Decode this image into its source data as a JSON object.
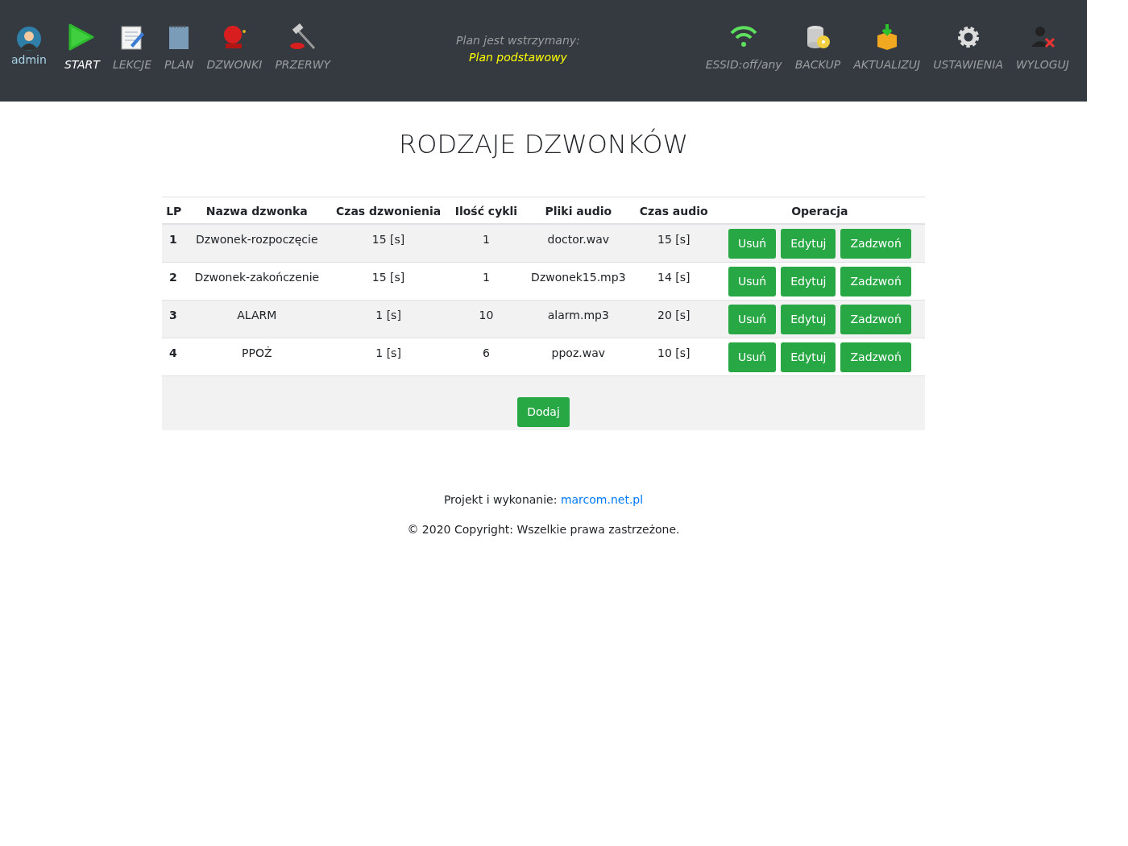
{
  "user": {
    "name": "admin"
  },
  "nav_left": [
    {
      "kind": "play",
      "label": "START",
      "selected": true
    },
    {
      "kind": "notepad",
      "label": "LEKCJE",
      "selected": false
    },
    {
      "kind": "notebook",
      "label": "PLAN",
      "selected": false
    },
    {
      "kind": "bell",
      "label": "DZWONKI",
      "selected": false
    },
    {
      "kind": "hammer",
      "label": "PRZERWY",
      "selected": false
    }
  ],
  "plan_status": {
    "line_1": "Plan jest wstrzymany:",
    "line_2": "Plan podstawowy"
  },
  "nav_right": [
    {
      "kind": "wifi",
      "label": "ESSID:off/any"
    },
    {
      "kind": "database",
      "label": "BACKUP"
    },
    {
      "kind": "box",
      "label": "AKTUALIZUJ"
    },
    {
      "kind": "gear",
      "label": "USTAWIENIA"
    },
    {
      "kind": "logout",
      "label": "WYLOGUJ"
    }
  ],
  "title": "RODZAJE DZWONKÓW",
  "table": {
    "columns": [
      "LP",
      "Nazwa dzwonka",
      "Czas dzwonienia",
      "Ilość cykli",
      "Pliki audio",
      "Czas audio",
      "Operacja"
    ],
    "rows": [
      {
        "lp": "1",
        "name": "Dzwonek-rozpoczęcie",
        "ring_time": "15 [s]",
        "cycles": "1",
        "file": "doctor.wav",
        "audio_time": "15 [s]",
        "buttons": [
          "Usuń",
          "Edytuj",
          "Zadzwoń"
        ]
      },
      {
        "lp": "2",
        "name": "Dzwonek-zakończenie",
        "ring_time": "15 [s]",
        "cycles": "1",
        "file": "Dzwonek15.mp3",
        "audio_time": "14 [s]",
        "buttons": [
          "Usuń",
          "Edytuj",
          "Zadzwoń"
        ]
      },
      {
        "lp": "3",
        "name": "ALARM",
        "ring_time": "1 [s]",
        "cycles": "10",
        "file": "alarm.mp3",
        "audio_time": "20 [s]",
        "buttons": [
          "Usuń",
          "Edytuj",
          "Zadzwoń"
        ]
      },
      {
        "lp": "4",
        "name": "PPOŻ",
        "ring_time": "1 [s]",
        "cycles": "6",
        "file": "ppoz.wav",
        "audio_time": "10 [s]",
        "buttons": [
          "Usuń",
          "Edytuj",
          "Zadzwoń"
        ]
      }
    ],
    "add_button": "Dodaj"
  },
  "footer": {
    "credit": "Projekt i wykonanie:",
    "link": "marcom.net.pl",
    "copyright": "© 2020 Copyright: Wszelkie prawa zastrzeżone."
  }
}
